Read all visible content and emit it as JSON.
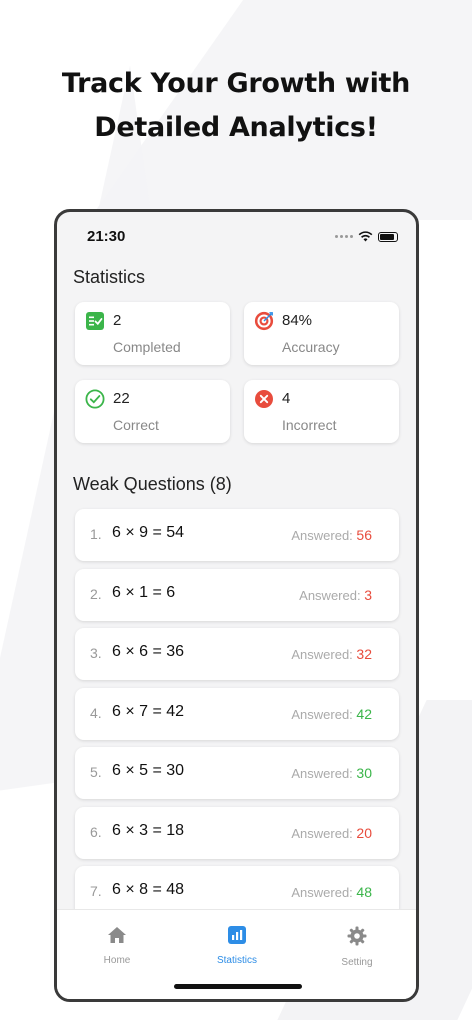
{
  "headline": {
    "line1": "Track Your Growth with",
    "line2": "Detailed Analytics!"
  },
  "status_bar": {
    "time": "21:30"
  },
  "statistics": {
    "title": "Statistics",
    "cards": [
      {
        "value": "2",
        "label": "Completed",
        "icon": "checklist-icon",
        "color": "#3bb54a"
      },
      {
        "value": "84%",
        "label": "Accuracy",
        "icon": "target-icon",
        "color": "#e84c3d"
      },
      {
        "value": "22",
        "label": "Correct",
        "icon": "check-circle-icon",
        "color": "#3bb54a"
      },
      {
        "value": "4",
        "label": "Incorrect",
        "icon": "x-circle-icon",
        "color": "#e84c3d"
      }
    ]
  },
  "weak_questions": {
    "title": "Weak Questions (8)",
    "answered_label": "Answered:",
    "items": [
      {
        "num": "1.",
        "text": "6 × 9 = 54",
        "answer": "56",
        "status": "wrong"
      },
      {
        "num": "2.",
        "text": "6 × 1 = 6",
        "answer": "3",
        "status": "wrong"
      },
      {
        "num": "3.",
        "text": "6 × 6 = 36",
        "answer": "32",
        "status": "wrong"
      },
      {
        "num": "4.",
        "text": "6 × 7 = 42",
        "answer": "42",
        "status": "right"
      },
      {
        "num": "5.",
        "text": "6 × 5 = 30",
        "answer": "30",
        "status": "right"
      },
      {
        "num": "6.",
        "text": "6 × 3 = 18",
        "answer": "20",
        "status": "wrong"
      },
      {
        "num": "7.",
        "text": "6 × 8 = 48",
        "answer": "48",
        "status": "right"
      }
    ]
  },
  "colors": {
    "wrong": "#e84c3d",
    "right": "#3bb54a",
    "accent": "#2d8de6"
  },
  "tab_bar": {
    "tabs": [
      {
        "label": "Home",
        "icon": "home-icon",
        "active": false
      },
      {
        "label": "Statistics",
        "icon": "chart-icon",
        "active": true
      },
      {
        "label": "Setting",
        "icon": "gear-icon",
        "active": false
      }
    ]
  }
}
